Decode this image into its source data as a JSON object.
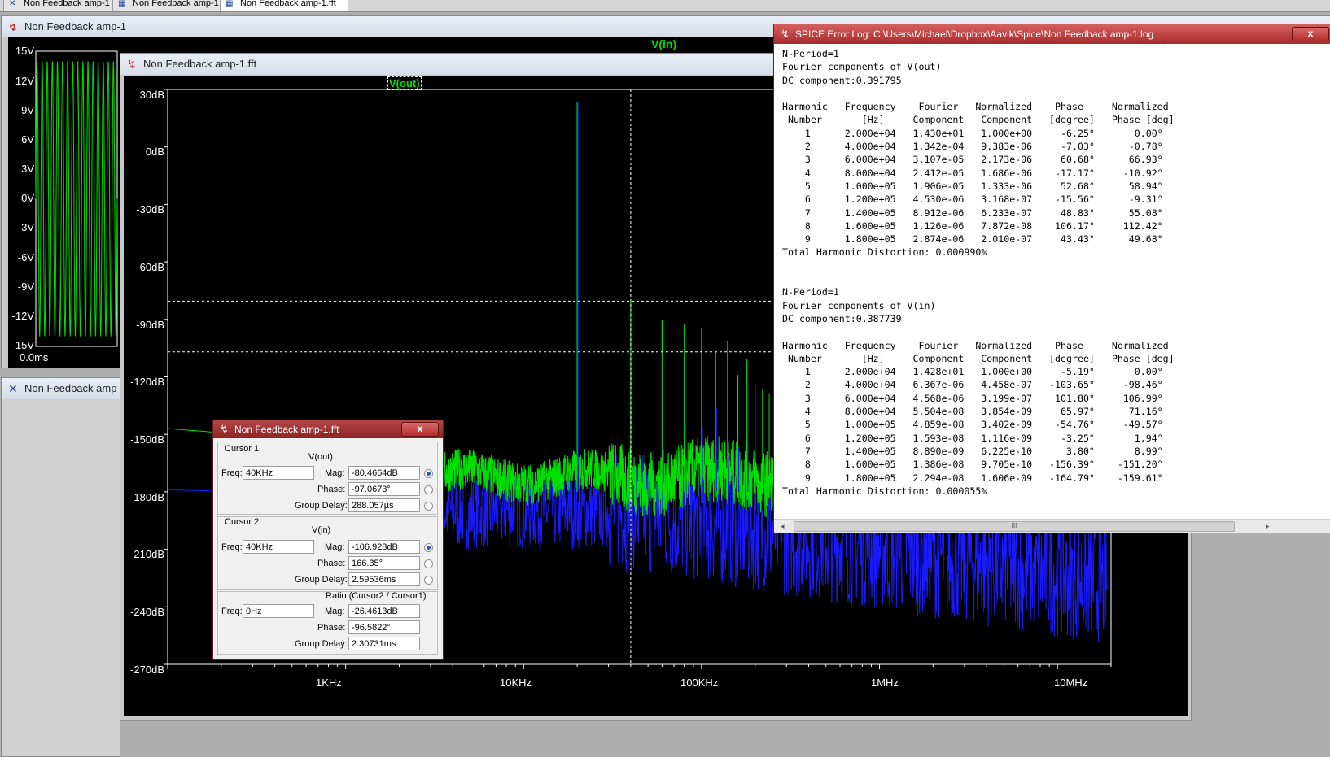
{
  "tabs": [
    {
      "label": "Non Feedback amp-1"
    },
    {
      "label": "Non Feedback amp-1"
    },
    {
      "label": "Non Feedback amp-1.fft"
    }
  ],
  "transient_window": {
    "title": "Non Feedback amp-1",
    "trace_label": "V(in)",
    "y_ticks": [
      "15V",
      "12V",
      "9V",
      "6V",
      "3V",
      "0V",
      "-3V",
      "-6V",
      "-9V",
      "-12V",
      "-15V"
    ],
    "x_start": "0.0ms"
  },
  "second_window": {
    "title": "Non Feedback amp-1"
  },
  "fft_window": {
    "title": "Non Feedback amp-1.fft",
    "trace_label": "V(out)",
    "y_ticks": [
      "30dB",
      "0dB",
      "-30dB",
      "-60dB",
      "-90dB",
      "-120dB",
      "-150dB",
      "-180dB",
      "-210dB",
      "-240dB",
      "-270dB"
    ],
    "x_ticks": [
      "1KHz",
      "10KHz",
      "100KHz",
      "1MHz",
      "10MHz"
    ]
  },
  "chart_data": {
    "type": "line",
    "x_scale": "log",
    "xlabel": "",
    "ylabel": "",
    "xlim": [
      100,
      20000000
    ],
    "ylim": [
      -270,
      30
    ],
    "x_ticks": [
      "1KHz",
      "10KHz",
      "100KHz",
      "1MHz",
      "10MHz"
    ],
    "y_ticks": [
      30,
      0,
      -30,
      -60,
      -90,
      -120,
      -150,
      -180,
      -210,
      -240,
      -270
    ],
    "series": [
      {
        "name": "V(out)",
        "color": "#00e000",
        "harmonics": [
          {
            "f": 20000,
            "db": 23.1
          },
          {
            "f": 40000,
            "db": -80.5
          },
          {
            "f": 60000,
            "db": -90.2
          },
          {
            "f": 80000,
            "db": -92.4
          },
          {
            "f": 100000,
            "db": -94.4
          },
          {
            "f": 120000,
            "db": -106.9
          },
          {
            "f": 140000,
            "db": -101.0
          },
          {
            "f": 160000,
            "db": -119.0
          },
          {
            "f": 180000,
            "db": -110.8
          }
        ]
      },
      {
        "name": "V(in)",
        "color": "#1a1aff",
        "harmonics": [
          {
            "f": 20000,
            "db": 23.1
          },
          {
            "f": 40000,
            "db": -106.9
          },
          {
            "f": 60000,
            "db": -106.8
          },
          {
            "f": 80000,
            "db": -145.2
          },
          {
            "f": 100000,
            "db": -146.3
          },
          {
            "f": 120000,
            "db": -136.0
          },
          {
            "f": 140000,
            "db": -161.0
          },
          {
            "f": 160000,
            "db": -157.2
          },
          {
            "f": 180000,
            "db": -152.8
          }
        ]
      }
    ],
    "cursor_freq": 40000,
    "cursor_levels": [
      -80.4664,
      -106.928
    ],
    "grid": false
  },
  "cursor_dialog": {
    "title": "Non Feedback amp-1.fft",
    "cursor1": {
      "heading": "Cursor 1",
      "trace": "V(out)",
      "freq_label": "Freq:",
      "freq": "40KHz",
      "mag_label": "Mag:",
      "mag": "-80.4664dB",
      "phase_label": "Phase:",
      "phase": "-97.0673°",
      "gd_label": "Group Delay:",
      "gd": "288.057µs"
    },
    "cursor2": {
      "heading": "Cursor 2",
      "trace": "V(in)",
      "freq_label": "Freq:",
      "freq": "40KHz",
      "mag_label": "Mag:",
      "mag": "-106.928dB",
      "phase_label": "Phase:",
      "phase": "166.35°",
      "gd_label": "Group Delay:",
      "gd": "2.59536ms"
    },
    "ratio": {
      "heading": "Ratio (Cursor2 / Cursor1)",
      "freq_label": "Freq:",
      "freq": "0Hz",
      "mag_label": "Mag:",
      "mag": "-26.4613dB",
      "phase_label": "Phase:",
      "phase": "-96.5822°",
      "gd_label": "Group Delay:",
      "gd": "2.30731ms"
    },
    "close_label": "x"
  },
  "error_log": {
    "title": "SPICE Error Log: C:\\Users\\Michael\\Dropbox\\Aavik\\Spice\\Non Feedback amp-1.log",
    "close_label": "x",
    "scroll_grip": "III",
    "text": "N-Period=1\nFourier components of V(out)\nDC component:0.391795\n\nHarmonic   Frequency    Fourier   Normalized    Phase     Normalized\n Number       [Hz]     Component   Component   [degree]   Phase [deg]\n    1      2.000e+04   1.430e+01   1.000e+00     -6.25°       0.00°\n    2      4.000e+04   1.342e-04   9.383e-06     -7.03°      -0.78°\n    3      6.000e+04   3.107e-05   2.173e-06     60.68°      66.93°\n    4      8.000e+04   2.412e-05   1.686e-06    -17.17°     -10.92°\n    5      1.000e+05   1.906e-05   1.333e-06     52.68°      58.94°\n    6      1.200e+05   4.530e-06   3.168e-07    -15.56°      -9.31°\n    7      1.400e+05   8.912e-06   6.233e-07     48.83°      55.08°\n    8      1.600e+05   1.126e-06   7.872e-08    106.17°     112.42°\n    9      1.800e+05   2.874e-06   2.010e-07     43.43°      49.68°\nTotal Harmonic Distortion: 0.000990%\n\n\nN-Period=1\nFourier components of V(in)\nDC component:0.387739\n\nHarmonic   Frequency    Fourier   Normalized    Phase     Normalized\n Number       [Hz]     Component   Component   [degree]   Phase [deg]\n    1      2.000e+04   1.428e+01   1.000e+00     -5.19°       0.00°\n    2      4.000e+04   6.367e-06   4.458e-07   -103.65°     -98.46°\n    3      6.000e+04   4.568e-06   3.199e-07    101.80°     106.99°\n    4      8.000e+04   5.504e-08   3.854e-09     65.97°      71.16°\n    5      1.000e+05   4.859e-08   3.402e-09    -54.76°     -49.57°\n    6      1.200e+05   1.593e-08   1.116e-09     -3.25°       1.94°\n    7      1.400e+05   8.890e-09   6.225e-10      3.80°       8.99°\n    8      1.600e+05   1.386e-08   9.705e-10   -156.39°    -151.20°\n    9      1.800e+05   2.294e-08   1.606e-09   -164.79°    -159.61°\nTotal Harmonic Distortion: 0.000055%"
  },
  "colors": {
    "vout": "#00e000",
    "vin": "#1a1aff",
    "cursor": "#ffffff",
    "log_title": "#b53434"
  }
}
